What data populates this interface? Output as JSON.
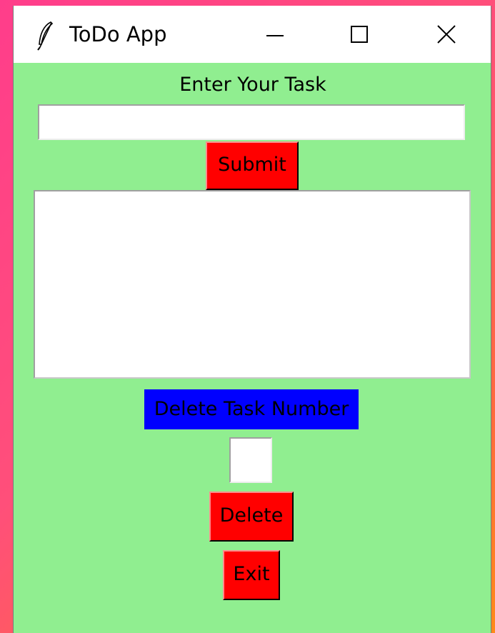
{
  "window": {
    "title": "ToDo App",
    "icon": "feather-icon",
    "controls": [
      "minimize-icon",
      "maximize-icon",
      "close-icon"
    ]
  },
  "colors": {
    "window_background": "#90ee90",
    "button_background": "#ff0000",
    "label_background": "#0000ff"
  },
  "form": {
    "prompt_label": "Enter Your Task",
    "task_input_value": "",
    "submit_label": "Submit"
  },
  "task_list": {
    "items": []
  },
  "delete_section": {
    "label": "Delete Task Number",
    "number_input_value": "",
    "delete_label": "Delete",
    "exit_label": "Exit"
  }
}
